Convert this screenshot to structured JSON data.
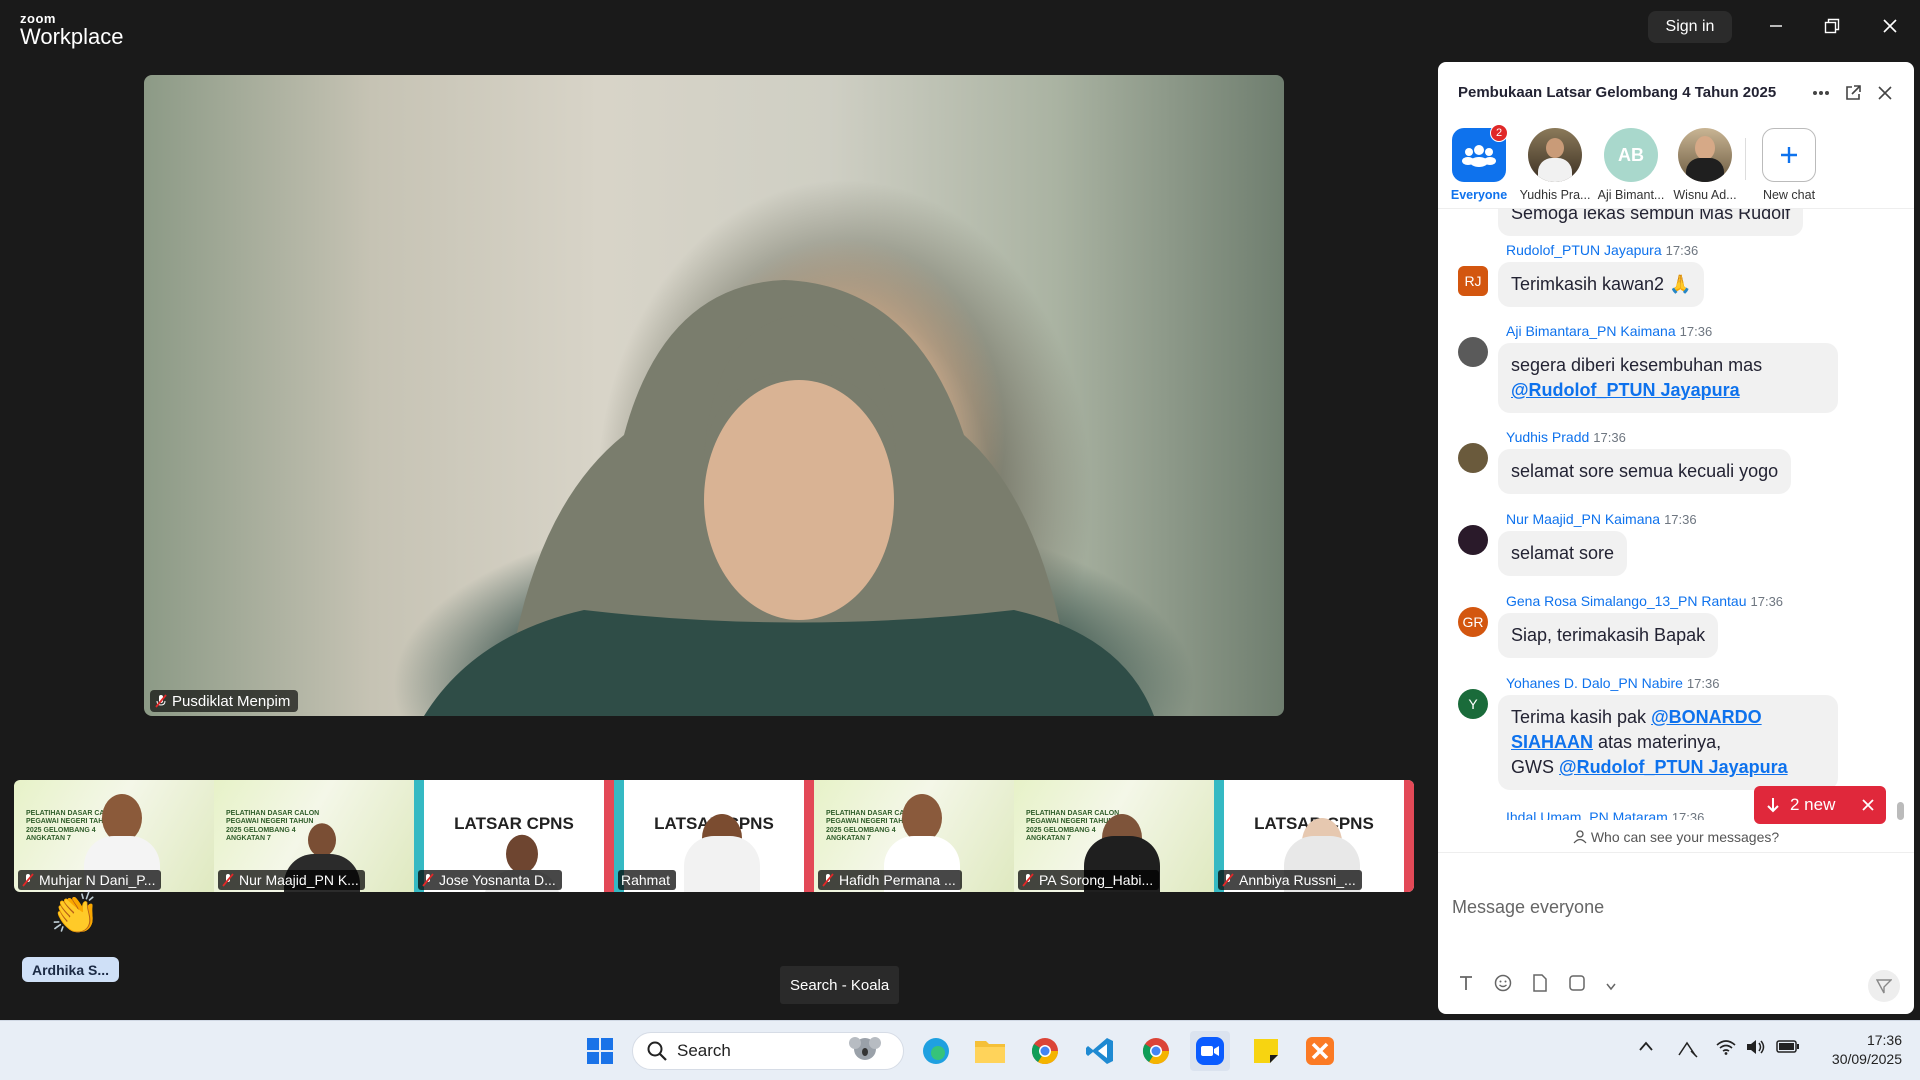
{
  "app": {
    "brand_small": "zoom",
    "brand_big": "Workplace",
    "signin_label": "Sign in"
  },
  "meeting": {
    "speaker_name": "Pusdiklat Menpim",
    "reaction": "👏",
    "raised_name": "Ardhika S...",
    "tooltip": "Search - Koala",
    "gallery": [
      {
        "name": "Muhjar N Dani_P..."
      },
      {
        "name": "Nur Maajid_PN K..."
      },
      {
        "name": "Jose Yosnanta D..."
      },
      {
        "name": "Rahmat"
      },
      {
        "name": "Hafidh Permana ..."
      },
      {
        "name": "PA Sorong_Habi..."
      },
      {
        "name": "Annbiya Russni_..."
      }
    ],
    "poster_green": "PELATIHAN DASAR CALON PEGAWAI NEGERI TAHUN 2025 GELOMBANG 4 ANGKATAN 7",
    "poster_white": "LATSAR CPNS"
  },
  "chat": {
    "title": "Pembukaan Latsar Gelombang 4 Tahun 2025",
    "tabs": [
      {
        "label": "Everyone",
        "badge": "2"
      },
      {
        "label": "Yudhis Pra..."
      },
      {
        "label": "Aji Bimant...",
        "initials": "AB"
      },
      {
        "label": "Wisnu Ad..."
      },
      {
        "label": "New chat"
      }
    ],
    "partial_top": "Semoga lekas sembuh Mas Rudolf",
    "messages": [
      {
        "sender": "Rudolof_PTUN Jayapura",
        "time": "17:36",
        "initials": "RJ",
        "color": "#d3560f",
        "text": "Terimkasih kawan2 🙏"
      },
      {
        "sender": "Aji Bimantara_PN Kaimana",
        "time": "17:36",
        "initials": "",
        "color": "#444444",
        "text": "segera diberi kesembuhan mas",
        "mention": "@Rudolof_PTUN Jayapura"
      },
      {
        "sender": "Yudhis Pradd",
        "time": "17:36",
        "initials": "",
        "color": "#6a5a3c",
        "text": "selamat sore semua kecuali yogo"
      },
      {
        "sender": "Nur Maajid_PN Kaimana",
        "time": "17:36",
        "initials": "",
        "color": "#2a1a2a",
        "text": "selamat sore"
      },
      {
        "sender": "Gena Rosa Simalango_13_PN Rantau",
        "time": "17:36",
        "initials": "GR",
        "color": "#d3560f",
        "text": "Siap, terimakasih Bapak"
      },
      {
        "sender": "Yohanes D. Dalo_PN Nabire",
        "time": "17:36",
        "initials": "Y",
        "color": "#1a6b3a",
        "text_before": "Terima kasih pak",
        "mention1": "@BONARDO SIAHAAN",
        "text_mid": "atas materinya,",
        "text_gws": "GWS",
        "mention2": "@Rudolof_PTUN Jayapura"
      },
      {
        "sender": "Ihdal Umam_PN Mataram",
        "time": "17:36"
      }
    ],
    "new_label": "2 new",
    "who_can_see": "Who can see your messages?",
    "input_placeholder": "Message everyone"
  },
  "taskbar": {
    "search_label": "Search",
    "time": "17:36",
    "date": "30/09/2025"
  }
}
